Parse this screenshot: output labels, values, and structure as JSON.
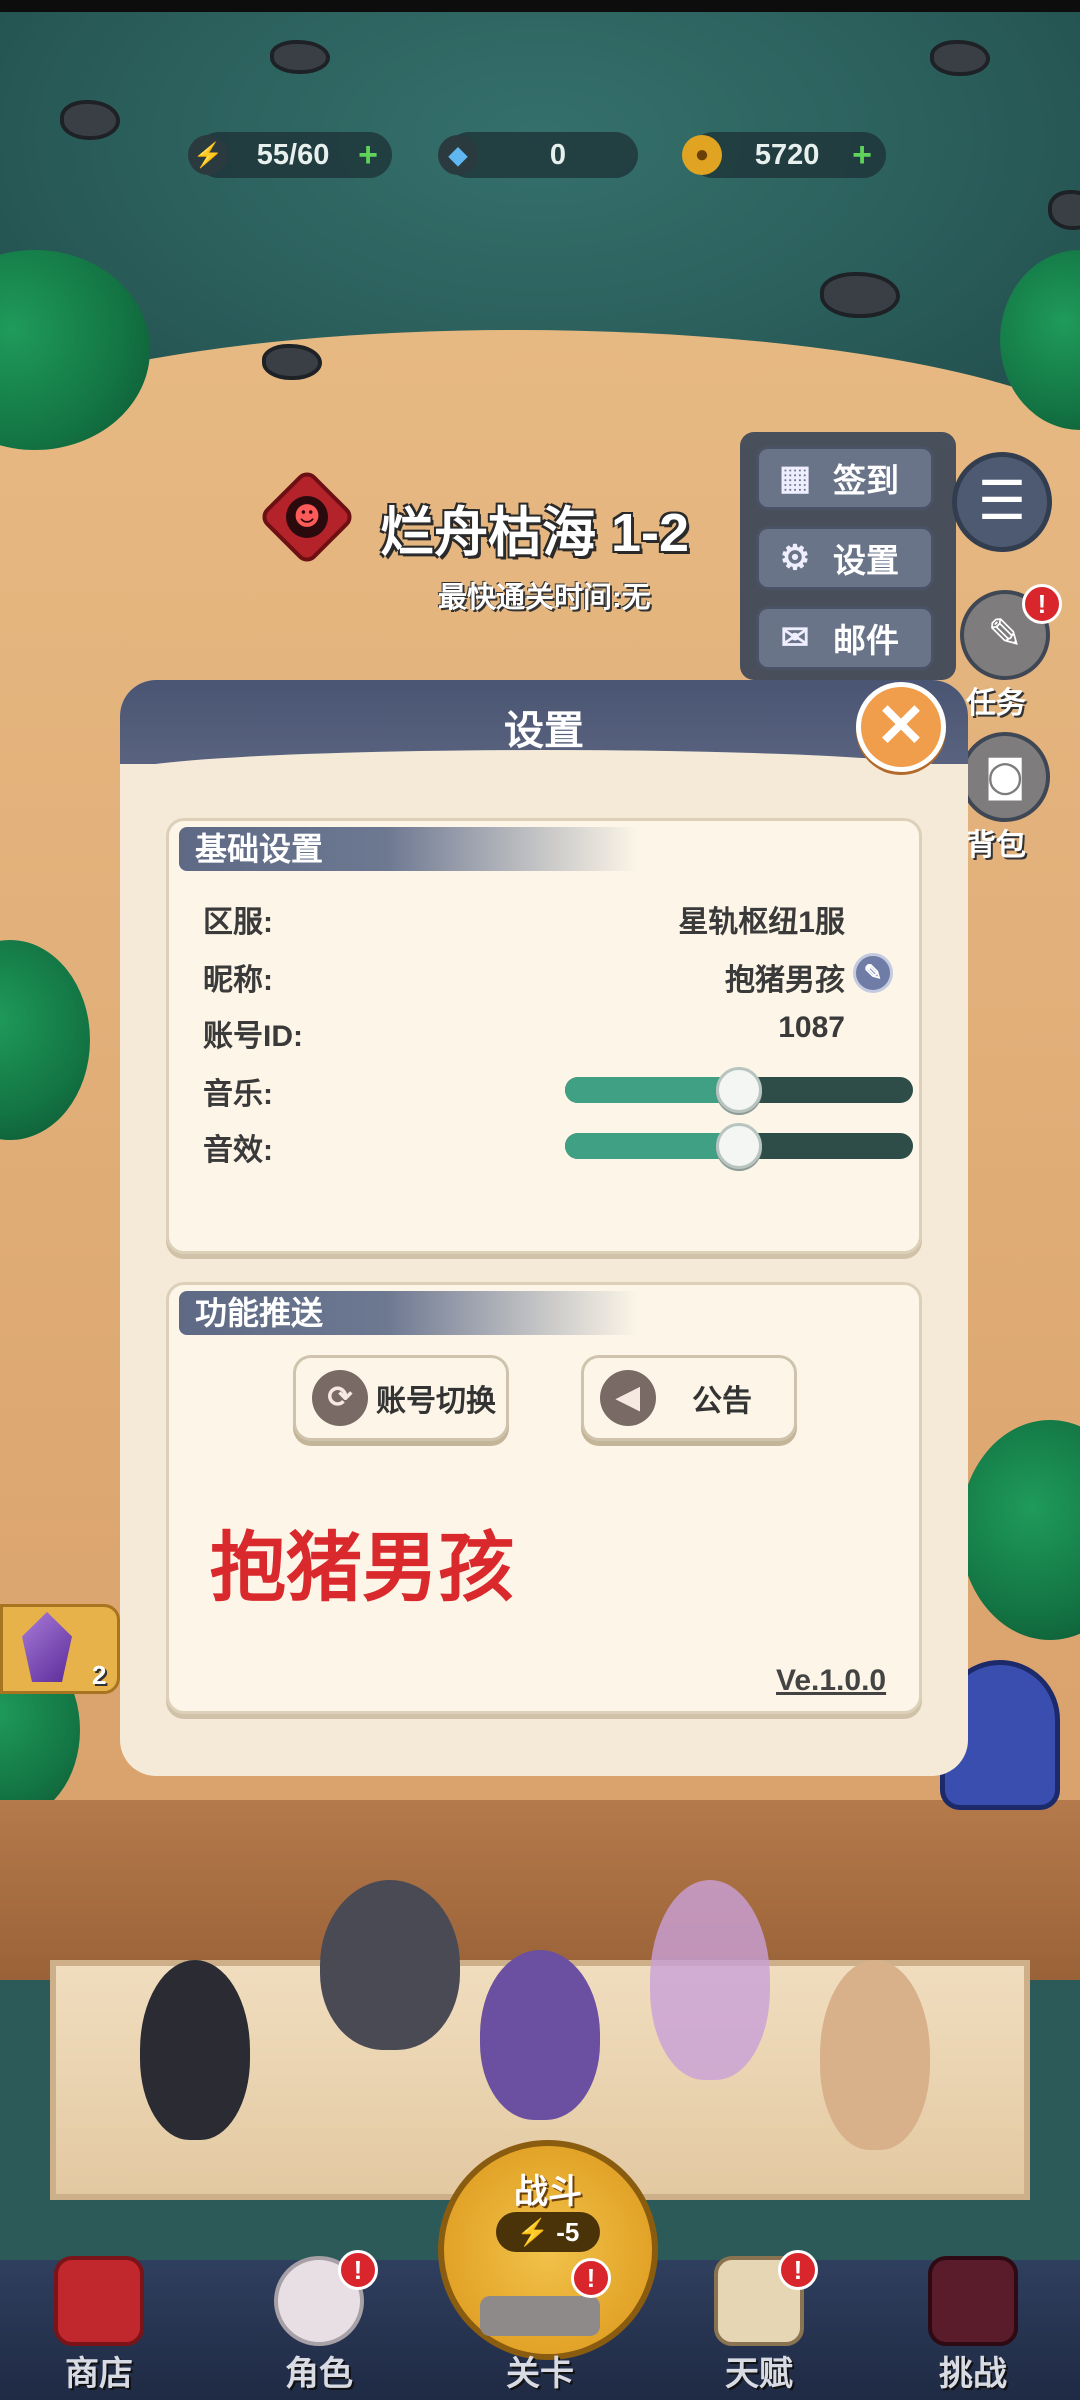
{
  "resources": {
    "energy": {
      "value": "55/60",
      "icon": "lightning-icon",
      "color": "#f2c230"
    },
    "gems": {
      "value": "0",
      "icon": "diamond-icon",
      "color": "#5fb6f0"
    },
    "gold": {
      "value": "5720",
      "icon": "coin-icon",
      "color": "#e0a422"
    }
  },
  "level": {
    "title": "烂舟枯海 1-2",
    "subtitle": "最快通关时间:无"
  },
  "side_menu": {
    "checkin_label": "签到",
    "settings_label": "设置",
    "mail_label": "邮件",
    "tasks_label": "任务",
    "bag_label": "背包",
    "alert_mark": "!"
  },
  "dialog": {
    "title": "设置",
    "basic": {
      "header": "基础设置",
      "server_label": "区服:",
      "server_value": "星轨枢纽1服",
      "nickname_label": "昵称:",
      "nickname_value": "抱猪男孩",
      "account_id_label": "账号ID:",
      "account_id_value": "1087",
      "music_label": "音乐:",
      "music_level": 0.5,
      "sfx_label": "音效:",
      "sfx_level": 0.5
    },
    "features": {
      "header": "功能推送",
      "switch_account_label": "账号切换",
      "announcement_label": "公告",
      "nickname_display": "抱猪男孩",
      "version": "Ve.1.0.0"
    }
  },
  "left_side": {
    "crystal_count": "2"
  },
  "battle": {
    "label": "战斗",
    "cost": "-5"
  },
  "bottom_nav": {
    "shop": "商店",
    "character": "角色",
    "stage": "关卡",
    "talent": "天赋",
    "challenge": "挑战"
  },
  "colors": {
    "slider_fill": "#3fa083",
    "slider_track": "#2f4d48",
    "close_button": "#f09e4c",
    "nickname_red": "#d9292c"
  }
}
